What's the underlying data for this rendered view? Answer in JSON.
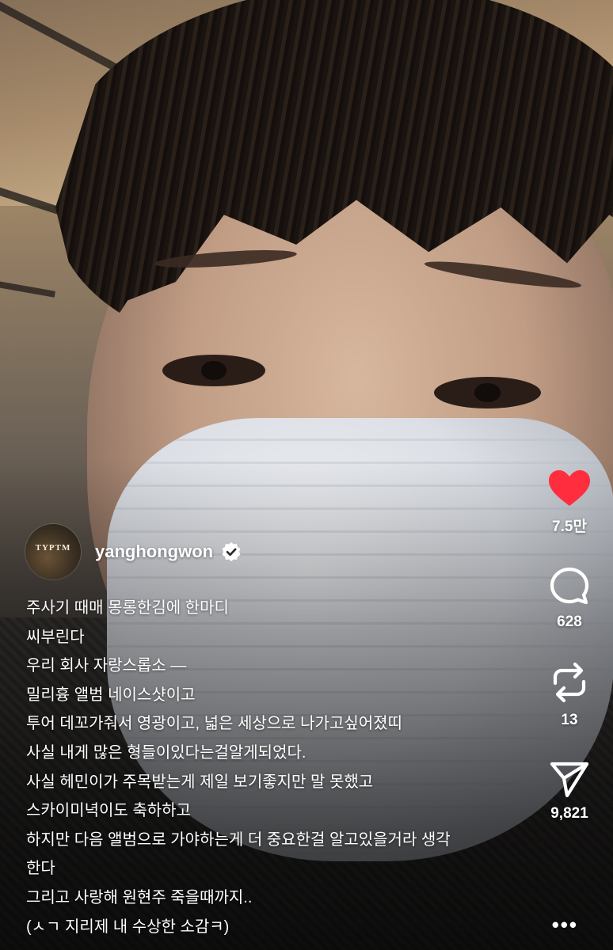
{
  "post": {
    "username": "yanghongwon",
    "avatar_text": "TYPTM",
    "verified": true,
    "caption_lines": [
      "주사기 때매 몽롱한김에 한마디",
      "씨부린다",
      "우리 회사 자랑스롭소 —",
      "밀리흉 앨범 네이스샷이고",
      "투어 데꼬가줘서 영광이고, 넓은 세상으로 나가고싶어졌띠",
      "사실 내게 많은 형들이있다는걸알게되었다.",
      "사실 헤민이가 주목받는게 제일 보기좋지만 말 못했고",
      "스카이미녁이도 축하하고",
      "하지만 다음 앨범으로 가야하는게 더 중요한걸 알고있을거라 생각",
      "한다",
      "그리고 사랑해 원현주 죽을때까지..",
      "(ㅅㄱ 지리제 내 수상한 소감ㅋ)"
    ]
  },
  "actions": {
    "like_count": "7.5만",
    "comment_count": "628",
    "repost_count": "13",
    "share_count": "9,821",
    "like_color": "#ff2d3d"
  },
  "icons": {
    "like": "heart-icon",
    "comment": "comment-bubble-icon",
    "repost": "repost-icon",
    "share": "send-icon",
    "more": "more-dots-icon",
    "verified": "verified-badge-icon"
  }
}
